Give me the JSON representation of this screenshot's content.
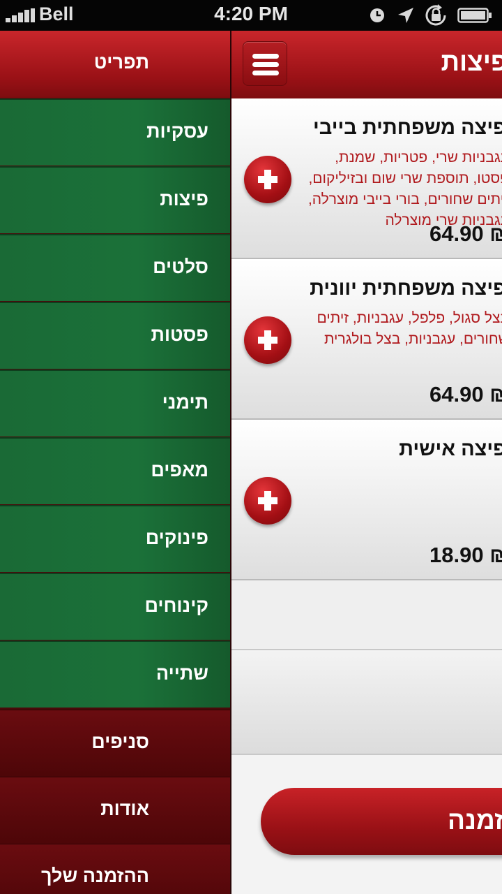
{
  "status_bar": {
    "carrier": "Bell",
    "time": "4:20 PM"
  },
  "drawer": {
    "title": "תפריט",
    "items": [
      {
        "label": "עסקיות"
      },
      {
        "label": "פיצות"
      },
      {
        "label": "סלטים"
      },
      {
        "label": "פסטות"
      },
      {
        "label": "תימני"
      },
      {
        "label": "מאפים"
      },
      {
        "label": "פינוקים"
      },
      {
        "label": "קינוחים"
      },
      {
        "label": "שתייה"
      }
    ],
    "footer_items": [
      {
        "label": "סניפים"
      },
      {
        "label": "אודות"
      },
      {
        "label": "ההזמנה שלך"
      }
    ]
  },
  "panel": {
    "title": "פיצות",
    "products": [
      {
        "name": "פיצה משפחתית בייבי",
        "description": "עגבניות שרי, פטריות, שמנת, פסטו, תוספת שרי שום ובזיליקום, זיתים שחורים, בורי בייבי מוצרלה, עגבניות שרי מוצרלה",
        "price": "64.90 ₪"
      },
      {
        "name": "פיצה משפחתית יוונית",
        "description": "בצל סגול, פלפל, עגבניות, זיתים שחורים, עגבניות, בצל בולגרית",
        "price": "64.90 ₪"
      },
      {
        "name": "פיצה אישית",
        "description": "",
        "price": "18.90 ₪"
      }
    ],
    "order_button": "ההזמנה"
  },
  "colors": {
    "brand_red": "#b51e23",
    "menu_green": "#1b7139",
    "footer_red": "#5a0709",
    "description_red": "#b0191d"
  }
}
